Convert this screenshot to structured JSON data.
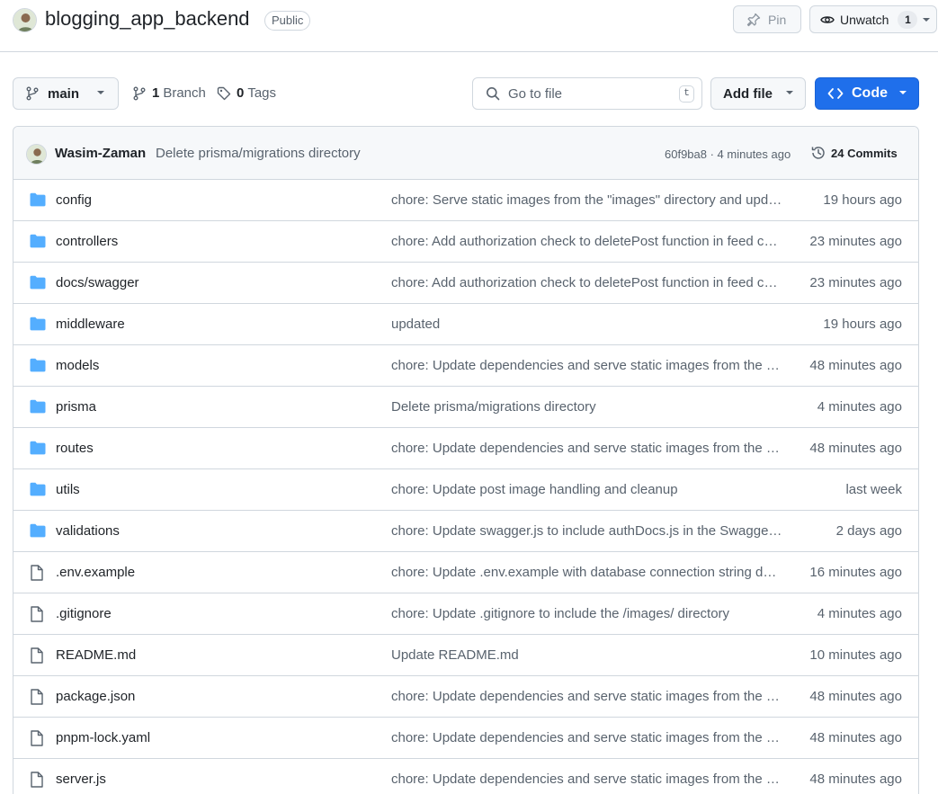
{
  "repo": {
    "name": "blogging_app_backend",
    "visibility": "Public",
    "pin_label": "Pin",
    "watch_label": "Unwatch",
    "watch_count": "1"
  },
  "toolbar": {
    "branch": "main",
    "branch_count": "1",
    "branch_label": "Branch",
    "tag_count": "0",
    "tag_label": "Tags",
    "search_placeholder": "Go to file",
    "search_shortcut": "t",
    "add_file_label": "Add file",
    "code_label": "Code"
  },
  "latest_commit": {
    "author": "Wasim-Zaman",
    "message": "Delete prisma/migrations directory",
    "meta": "60f9ba8 · 4 minutes ago",
    "commits_label": "24 Commits"
  },
  "colors": {
    "folder": "#54aeff",
    "accent": "#1f6feb",
    "muted": "#59636e",
    "border": "#d0d7de"
  },
  "files": [
    {
      "type": "folder",
      "name": "config",
      "message": "chore: Serve static images from the \"images\" directory and update",
      "time": "19 hours ago"
    },
    {
      "type": "folder",
      "name": "controllers",
      "message": "chore: Add authorization check to deletePost function in feed controller",
      "time": "23 minutes ago"
    },
    {
      "type": "folder",
      "name": "docs/swagger",
      "message": "chore: Add authorization check to deletePost function in feed controller",
      "time": "23 minutes ago"
    },
    {
      "type": "folder",
      "name": "middleware",
      "message": "updated",
      "time": "19 hours ago"
    },
    {
      "type": "folder",
      "name": "models",
      "message": "chore: Update dependencies and serve static images from the images directory",
      "time": "48 minutes ago"
    },
    {
      "type": "folder",
      "name": "prisma",
      "message": "Delete prisma/migrations directory",
      "time": "4 minutes ago"
    },
    {
      "type": "folder",
      "name": "routes",
      "message": "chore: Update dependencies and serve static images from the images directory",
      "time": "48 minutes ago"
    },
    {
      "type": "folder",
      "name": "utils",
      "message": "chore: Update post image handling and cleanup",
      "time": "last week"
    },
    {
      "type": "folder",
      "name": "validations",
      "message": "chore: Update swagger.js to include authDocs.js in the Swagger docs",
      "time": "2 days ago"
    },
    {
      "type": "file",
      "name": ".env.example",
      "message": "chore: Update .env.example with database connection string details",
      "time": "16 minutes ago"
    },
    {
      "type": "file",
      "name": ".gitignore",
      "message": "chore: Update .gitignore to include the /images/ directory",
      "time": "4 minutes ago"
    },
    {
      "type": "file",
      "name": "README.md",
      "message": "Update README.md",
      "time": "10 minutes ago"
    },
    {
      "type": "file",
      "name": "package.json",
      "message": "chore: Update dependencies and serve static images from the images directory",
      "time": "48 minutes ago"
    },
    {
      "type": "file",
      "name": "pnpm-lock.yaml",
      "message": "chore: Update dependencies and serve static images from the images directory",
      "time": "48 minutes ago"
    },
    {
      "type": "file",
      "name": "server.js",
      "message": "chore: Update dependencies and serve static images from the images directory",
      "time": "48 minutes ago"
    }
  ]
}
